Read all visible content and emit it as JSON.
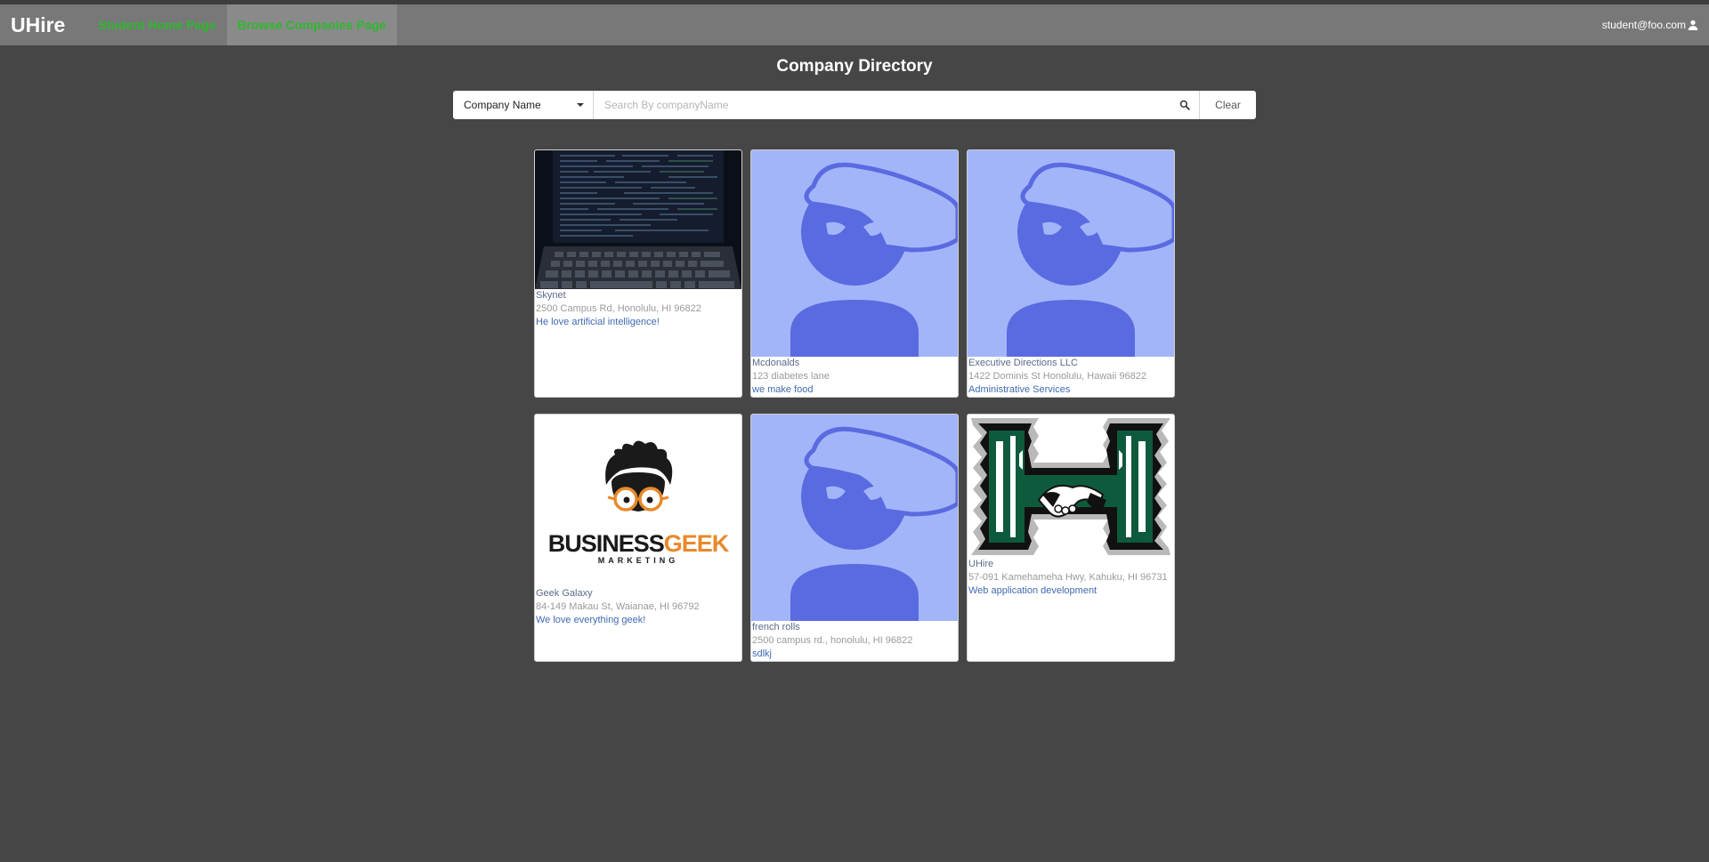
{
  "navbar": {
    "brand": "UHire",
    "links": [
      {
        "label": "Student Home Page",
        "active": false
      },
      {
        "label": "Browse Companies Page",
        "active": true
      }
    ],
    "user_email": "student@foo.com",
    "user_icon": "user-icon",
    "link_color": "#2eb82e"
  },
  "page": {
    "title": "Company Directory"
  },
  "search": {
    "filter_selected": "Company Name",
    "placeholder": "Search By companyName",
    "value": "",
    "search_icon": "search-icon",
    "clear_label": "Clear"
  },
  "companies": [
    {
      "name": "Skynet",
      "address": "2500 Campus Rd, Honolulu, HI 96822",
      "description": "He love artificial intelligence!",
      "image": "laptop-code-photo"
    },
    {
      "name": "Mcdonalds",
      "address": "123 diabetes lane",
      "description": "we make food",
      "image": "default-avatar-placeholder"
    },
    {
      "name": "Executive Directions LLC",
      "address": "1422 Dominis St Honolulu, Hawaii 96822",
      "description": "Administrative Services",
      "image": "default-avatar-placeholder"
    },
    {
      "name": "Geek Galaxy",
      "address": "84-149 Makau St, Waianae, HI 96792",
      "description": "We love everything geek!",
      "image": "business-geek-logo",
      "logo_text": {
        "word1": "BUSINESS",
        "word2": "GEEK",
        "tagline": "MARKETING"
      }
    },
    {
      "name": "french rolls",
      "address": "2500 campus rd., honolulu, HI 96822",
      "description": "sdlkj",
      "image": "default-avatar-placeholder"
    },
    {
      "name": "UHire",
      "address": "57-091 Kamehameha Hwy, Kahuku, HI 96731",
      "description": "Web application development",
      "image": "hawaii-h-handshake-logo"
    }
  ],
  "colors": {
    "background": "#464646",
    "navbar": "#787878",
    "avatar_bg": "#a2b5f9",
    "avatar_fg": "#5a6ae0"
  }
}
